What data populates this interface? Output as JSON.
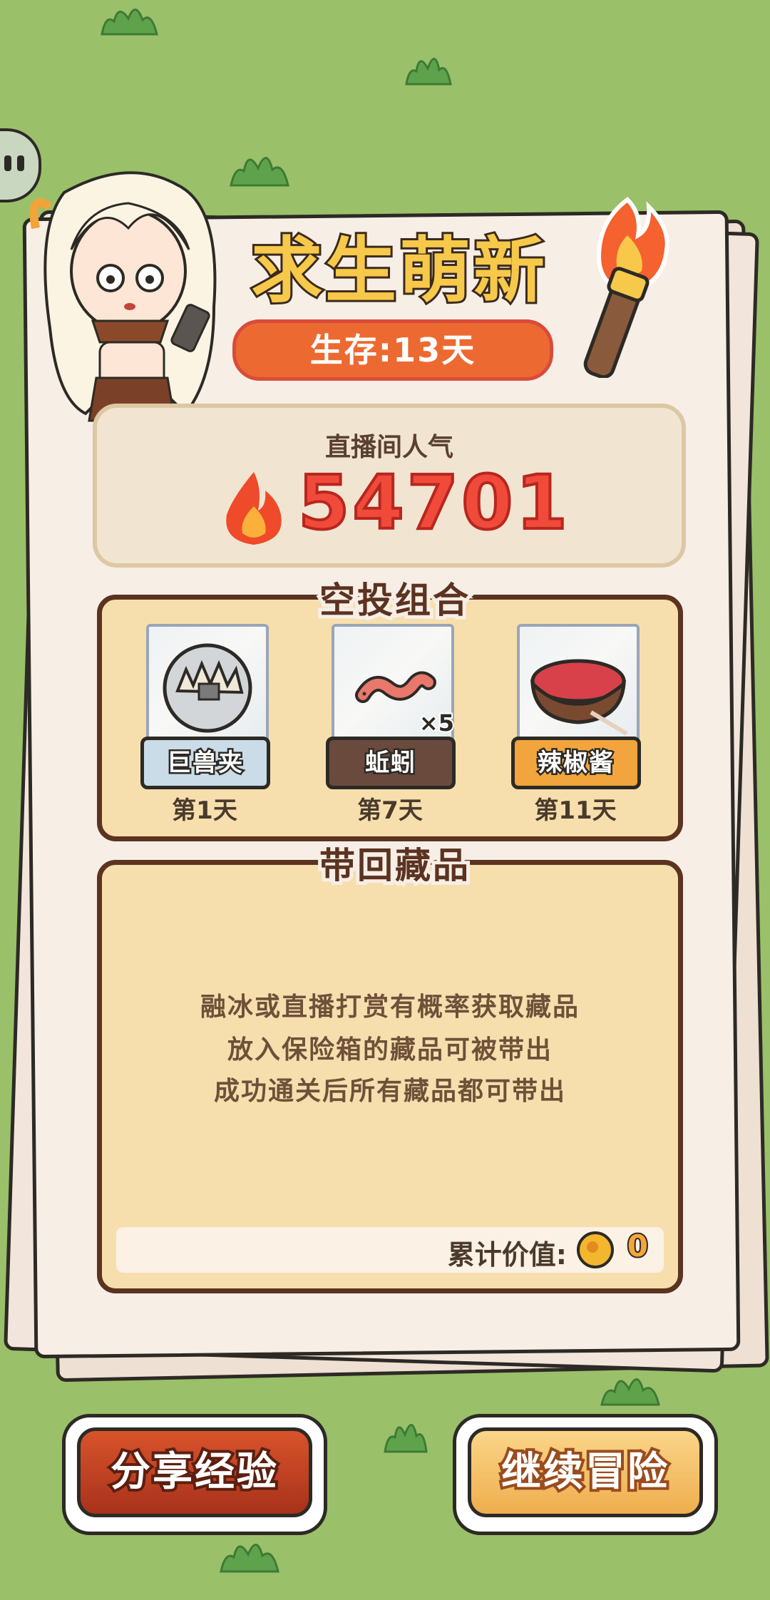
{
  "header": {
    "title": "求生萌新",
    "survival_badge": "生存:13天"
  },
  "popularity": {
    "label": "直播间人气",
    "value": "54701"
  },
  "airdrop": {
    "title": "空投组合",
    "items": [
      {
        "name": "巨兽夹",
        "day": "第1天",
        "label_color": "#c9dce8",
        "icon": "beast-trap-icon"
      },
      {
        "name": "蚯蚓",
        "day": "第7天",
        "count": "×5",
        "label_color": "#6b4a3e",
        "icon": "earthworm-icon"
      },
      {
        "name": "辣椒酱",
        "day": "第11天",
        "label_color": "#f1a53c",
        "icon": "chili-sauce-bowl-icon"
      }
    ]
  },
  "loot": {
    "title": "带回藏品",
    "lines": [
      "融冰或直播打赏有概率获取藏品",
      "放入保险箱的藏品可被带出",
      "成功通关后所有藏品都可带出"
    ],
    "value_label": "累计价值:",
    "value": "0"
  },
  "buttons": {
    "share": "分享经验",
    "continue": "继续冒险"
  },
  "colors": {
    "background": "#9ac06a",
    "accent_orange": "#ec6a31",
    "panel": "#f6dfad",
    "border_brown": "#5b3320"
  }
}
